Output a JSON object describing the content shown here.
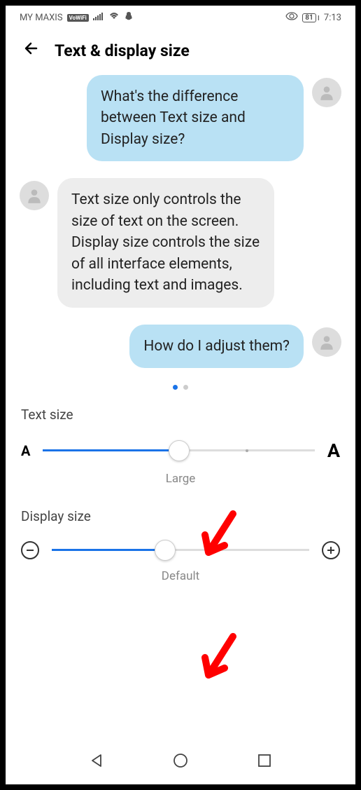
{
  "status": {
    "carrier": "MY MAXIS",
    "vowifi": "VoWiFi",
    "battery": "81",
    "time": "7:13"
  },
  "header": {
    "title": "Text & display size"
  },
  "chat": {
    "msg1": "What's the difference between Text size and Display size?",
    "msg2": "Text size only controls the size of text on the screen. Display size controls the size of all interface elements, including text and images.",
    "msg3": "How do I adjust them?"
  },
  "sliders": {
    "text": {
      "label": "Text size",
      "value_label": "Large",
      "icon_small": "A",
      "icon_large": "A",
      "fill_percent": 50
    },
    "display": {
      "label": "Display size",
      "value_label": "Default",
      "fill_percent": 44
    }
  }
}
